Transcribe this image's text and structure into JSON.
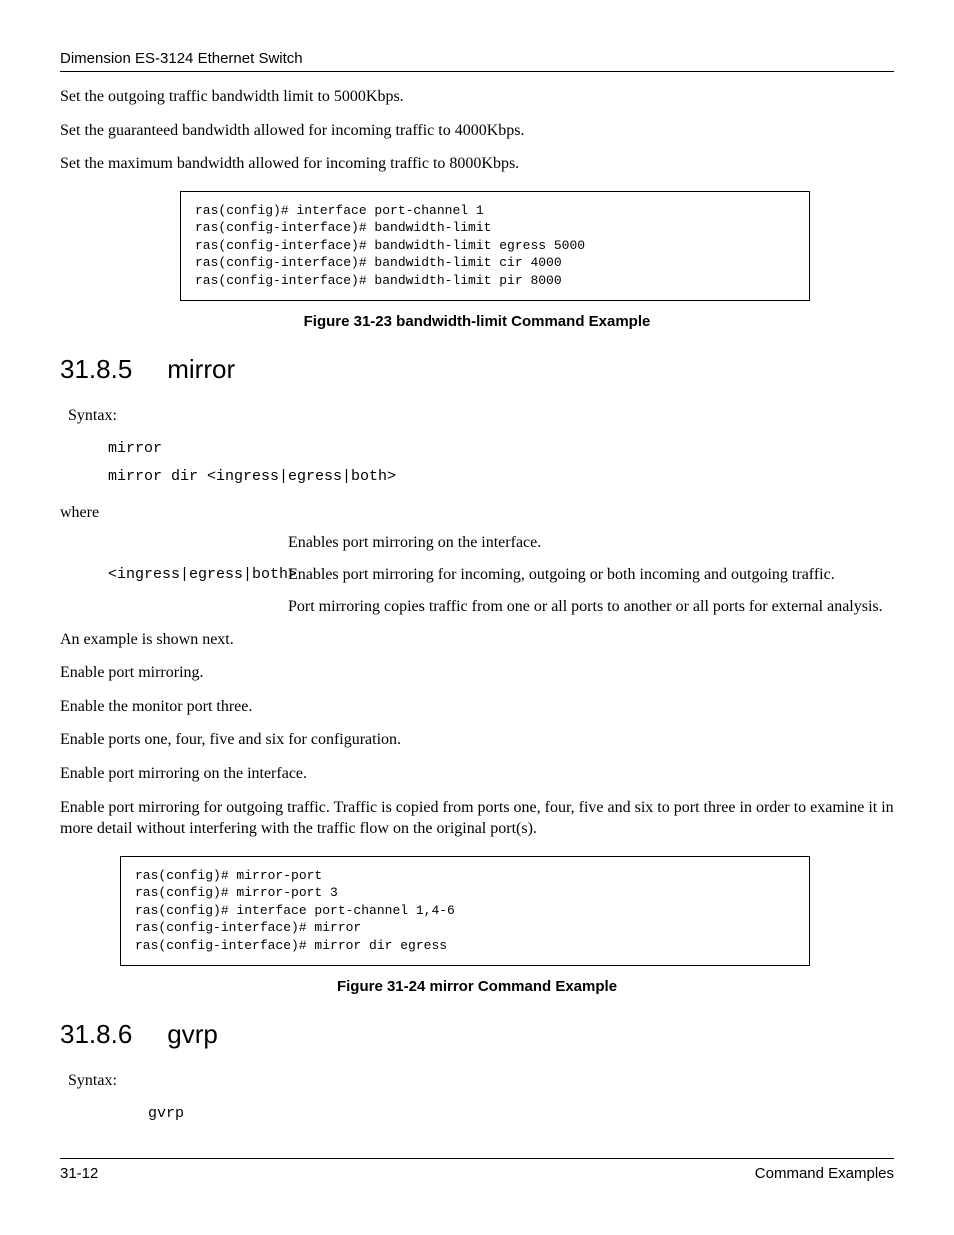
{
  "header": {
    "title": "Dimension ES-3124 Ethernet Switch"
  },
  "intro": {
    "p1": "Set the outgoing traffic bandwidth limit to 5000Kbps.",
    "p2": "Set the guaranteed bandwidth allowed for incoming traffic to 4000Kbps.",
    "p3": "Set the maximum bandwidth allowed for incoming traffic to 8000Kbps."
  },
  "code1": "ras(config)# interface port-channel 1\nras(config-interface)# bandwidth-limit\nras(config-interface)# bandwidth-limit egress 5000\nras(config-interface)# bandwidth-limit cir 4000\nras(config-interface)# bandwidth-limit pir 8000",
  "figure1": "Figure 31-23 bandwidth-limit Command Example",
  "section_mirror": {
    "number": "31.8.5",
    "title": "mirror",
    "syntax_label": "Syntax:",
    "syntax_lines": "mirror\nmirror dir <ingress|egress|both>",
    "where_label": "where",
    "params": [
      {
        "term": "",
        "desc": "Enables port mirroring on the interface."
      },
      {
        "term": "<ingress|egress|both>",
        "desc": "Enables port mirroring for incoming, outgoing or both incoming and outgoing traffic."
      },
      {
        "term": "",
        "desc": "Port mirroring copies traffic from one or all ports to another or all ports for external analysis."
      }
    ],
    "example_intro": "An example is shown next.",
    "steps": {
      "s1": "Enable port mirroring.",
      "s2": "Enable the monitor port three.",
      "s3": "Enable ports one, four, five and six for configuration.",
      "s4": "Enable port mirroring on the interface.",
      "s5": "Enable port mirroring for outgoing traffic. Traffic is copied from ports one, four, five and six to port three in order to examine it in more detail without interfering with the traffic flow on the original port(s)."
    }
  },
  "code2": "ras(config)# mirror-port\nras(config)# mirror-port 3\nras(config)# interface port-channel 1,4-6\nras(config-interface)# mirror\nras(config-interface)# mirror dir egress",
  "figure2": "Figure 31-24 mirror Command Example",
  "section_gvrp": {
    "number": "31.8.6",
    "title": "gvrp",
    "syntax_label": "Syntax:",
    "syntax_lines": "gvrp"
  },
  "footer": {
    "left": "31-12",
    "right": "Command Examples"
  }
}
